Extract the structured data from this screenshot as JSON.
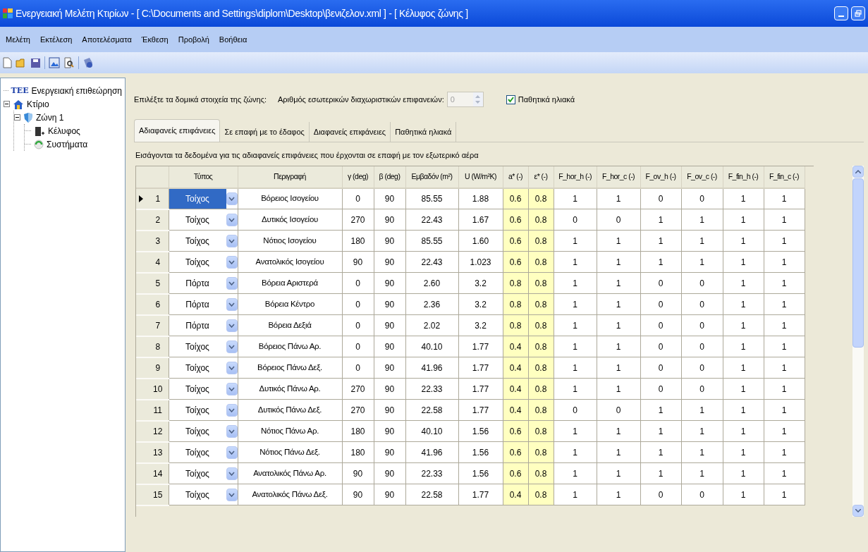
{
  "window": {
    "title": "Ενεργειακή Μελέτη Κτιρίων - [ C:\\Documents and Settings\\diplom\\Desktop\\βενιζελον.xml ] - [ Κέλυφος ζώνης ]"
  },
  "menu": [
    "Μελέτη",
    "Εκτέλεση",
    "Αποτελέσματα",
    "Έκθεση",
    "Προβολή",
    "Βοήθεια"
  ],
  "tree": [
    {
      "label": "Ενεργειακή επιθεώρηση",
      "logo": "ΤΕΕ",
      "kind": "logo"
    },
    {
      "label": "Κτίριο",
      "kind": "house",
      "expanded": true,
      "children": [
        {
          "label": "Ζώνη 1",
          "kind": "zone",
          "expanded": true,
          "children": [
            {
              "label": "Κέλυφος",
              "kind": "shell"
            },
            {
              "label": "Συστήματα",
              "kind": "systems"
            }
          ]
        }
      ]
    }
  ],
  "zone_prompt": "Επιλέξτε τα δομικά στοιχεία της ζώνης:",
  "partitions": {
    "label": "Αριθμός εσωτερικών διαχωριστικών επιφανειών:",
    "value": "0",
    "disabled": true
  },
  "passive_solar": {
    "label": "Παθητικά ηλιακά",
    "checked": true
  },
  "tabs": [
    {
      "label": "Αδιαφανείς επιφάνειες",
      "selected": true
    },
    {
      "label": "Σε επαφή με το έδαφος",
      "selected": false
    },
    {
      "label": "Διαφανείς επιφάνειες",
      "selected": false
    },
    {
      "label": "Παθητικά ηλιακά",
      "selected": false
    }
  ],
  "description": "Εισάγονται τα δεδομένα για τις αδιαφανείς επιφάνειες που έρχονται σε επαφή με τον εξωτερικό αέρα",
  "table": {
    "columns": [
      {
        "label": "Τύπος",
        "highlight": false
      },
      {
        "label": "Περιγραφή",
        "highlight": false
      },
      {
        "label": "γ (deg)",
        "highlight": false
      },
      {
        "label": "β (deg)",
        "highlight": false
      },
      {
        "label": "Εμβαδόν (m²)",
        "highlight": false
      },
      {
        "label": "U (W/m²K)",
        "highlight": false
      },
      {
        "label": "a* (-)",
        "highlight": true
      },
      {
        "label": "ε* (-)",
        "highlight": true
      },
      {
        "label": "F_hor_h (-)",
        "highlight": false
      },
      {
        "label": "F_hor_c (-)",
        "highlight": false
      },
      {
        "label": "F_ov_h (-)",
        "highlight": false
      },
      {
        "label": "F_ov_c (-)",
        "highlight": false
      },
      {
        "label": "F_fin_h (-)",
        "highlight": false
      },
      {
        "label": "F_fin_c (-)",
        "highlight": false
      }
    ],
    "rows": [
      {
        "number": "1",
        "selected": true,
        "type": "Τοίχος",
        "description": "Βόρειος Ισογείου",
        "values": [
          "0",
          "90",
          "85.55",
          "1.88",
          "0.6",
          "0.8",
          "1",
          "1",
          "0",
          "0",
          "1",
          "1"
        ]
      },
      {
        "number": "2",
        "selected": false,
        "type": "Τοίχος",
        "description": "Δυτικός Ισογείου",
        "values": [
          "270",
          "90",
          "22.43",
          "1.67",
          "0.6",
          "0.8",
          "0",
          "0",
          "1",
          "1",
          "1",
          "1"
        ]
      },
      {
        "number": "3",
        "selected": false,
        "type": "Τοίχος",
        "description": "Νότιος Ισογείου",
        "values": [
          "180",
          "90",
          "85.55",
          "1.60",
          "0.6",
          "0.8",
          "1",
          "1",
          "1",
          "1",
          "1",
          "1"
        ]
      },
      {
        "number": "4",
        "selected": false,
        "type": "Τοίχος",
        "description": "Ανατολικός Ισογείου",
        "values": [
          "90",
          "90",
          "22.43",
          "1.023",
          "0.6",
          "0.8",
          "1",
          "1",
          "1",
          "1",
          "1",
          "1"
        ]
      },
      {
        "number": "5",
        "selected": false,
        "type": "Πόρτα",
        "description": "Βόρεια Αριστερά",
        "values": [
          "0",
          "90",
          "2.60",
          "3.2",
          "0.8",
          "0.8",
          "1",
          "1",
          "0",
          "0",
          "1",
          "1"
        ]
      },
      {
        "number": "6",
        "selected": false,
        "type": "Πόρτα",
        "description": "Βόρεια Κέντρο",
        "values": [
          "0",
          "90",
          "2.36",
          "3.2",
          "0.8",
          "0.8",
          "1",
          "1",
          "0",
          "0",
          "1",
          "1"
        ]
      },
      {
        "number": "7",
        "selected": false,
        "type": "Πόρτα",
        "description": "Βόρεια Δεξιά",
        "values": [
          "0",
          "90",
          "2.02",
          "3.2",
          "0.8",
          "0.8",
          "1",
          "1",
          "0",
          "0",
          "1",
          "1"
        ]
      },
      {
        "number": "8",
        "selected": false,
        "type": "Τοίχος",
        "description": "Βόρειος Πάνω Αρ.",
        "values": [
          "0",
          "90",
          "40.10",
          "1.77",
          "0.4",
          "0.8",
          "1",
          "1",
          "0",
          "0",
          "1",
          "1"
        ]
      },
      {
        "number": "9",
        "selected": false,
        "type": "Τοίχος",
        "description": "Βόρειος Πάνω Δεξ.",
        "values": [
          "0",
          "90",
          "41.96",
          "1.77",
          "0.4",
          "0.8",
          "1",
          "1",
          "0",
          "0",
          "1",
          "1"
        ]
      },
      {
        "number": "10",
        "selected": false,
        "type": "Τοίχος",
        "description": "Δυτικός Πάνω Αρ.",
        "values": [
          "270",
          "90",
          "22.33",
          "1.77",
          "0.4",
          "0.8",
          "1",
          "1",
          "0",
          "0",
          "1",
          "1"
        ]
      },
      {
        "number": "11",
        "selected": false,
        "type": "Τοίχος",
        "description": "Δυτικός Πάνω Δεξ.",
        "values": [
          "270",
          "90",
          "22.58",
          "1.77",
          "0.4",
          "0.8",
          "0",
          "0",
          "1",
          "1",
          "1",
          "1"
        ]
      },
      {
        "number": "12",
        "selected": false,
        "type": "Τοίχος",
        "description": "Νότιος Πάνω Αρ.",
        "values": [
          "180",
          "90",
          "40.10",
          "1.56",
          "0.6",
          "0.8",
          "1",
          "1",
          "1",
          "1",
          "1",
          "1"
        ]
      },
      {
        "number": "13",
        "selected": false,
        "type": "Τοίχος",
        "description": "Νότιος Πάνω Δεξ.",
        "values": [
          "180",
          "90",
          "41.96",
          "1.56",
          "0.6",
          "0.8",
          "1",
          "1",
          "1",
          "1",
          "1",
          "1"
        ]
      },
      {
        "number": "14",
        "selected": false,
        "type": "Τοίχος",
        "description": "Ανατολικός Πάνω Αρ.",
        "values": [
          "90",
          "90",
          "22.33",
          "1.56",
          "0.6",
          "0.8",
          "1",
          "1",
          "1",
          "1",
          "1",
          "1"
        ]
      },
      {
        "number": "15",
        "selected": false,
        "type": "Τοίχος",
        "description": "Ανατολικός Πάνω Δεξ.",
        "values": [
          "90",
          "90",
          "22.58",
          "1.77",
          "0.4",
          "0.8",
          "1",
          "1",
          "0",
          "0",
          "1",
          "1"
        ]
      }
    ]
  }
}
